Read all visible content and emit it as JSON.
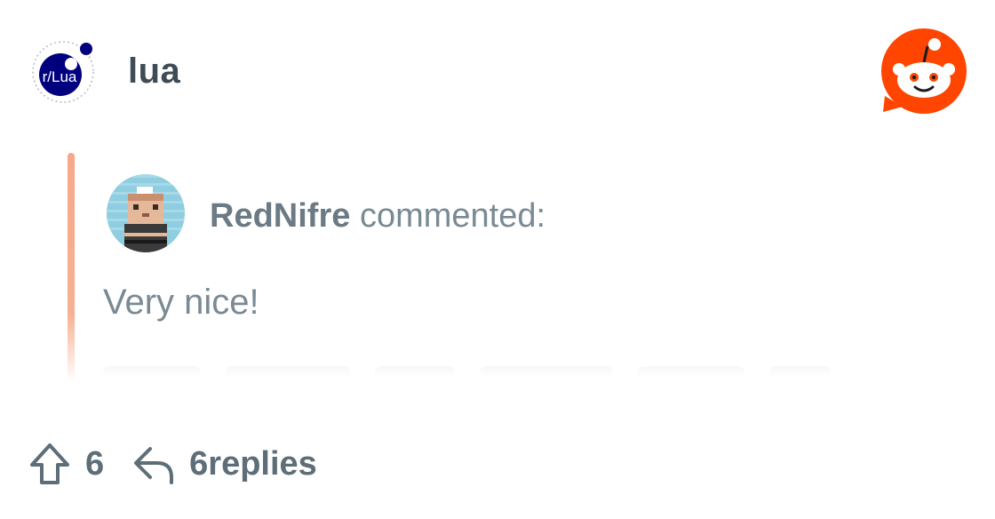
{
  "header": {
    "subreddit_avatar_text": "r/Lua",
    "subreddit_name": "lua"
  },
  "comment": {
    "author": "RedNifre",
    "action": "commented:",
    "body": "Very nice!"
  },
  "footer": {
    "score": "6",
    "replies": "6replies"
  },
  "colors": {
    "accent": "#ff4500",
    "quote_bar": "#f7a88a",
    "lua_blue": "#00007f",
    "text_muted": "#7a8a94"
  },
  "icons": {
    "upvote": "arrow-up-outline-icon",
    "reply": "reply-arrow-icon",
    "logo": "reddit-snoo-icon"
  }
}
